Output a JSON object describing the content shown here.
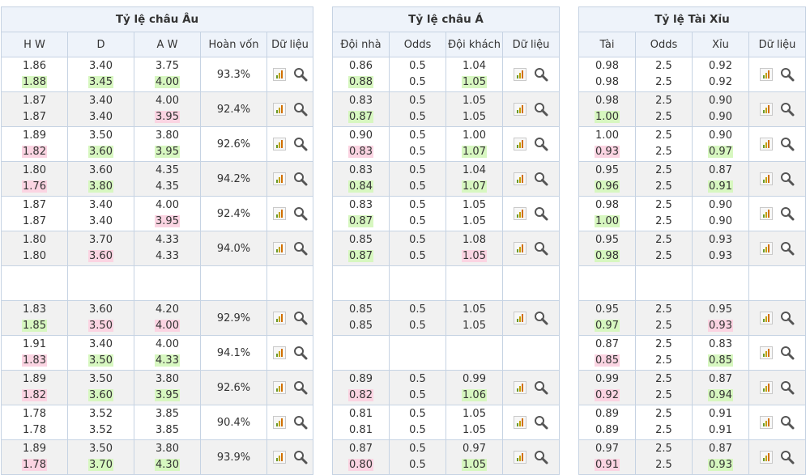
{
  "eu": {
    "title": "Tỷ lệ châu Âu",
    "headers": [
      "H W",
      "D",
      "A W",
      "Hoàn vốn",
      "Dữ liệu"
    ],
    "rows": [
      {
        "hw": [
          "1.86",
          "1.88"
        ],
        "d": [
          "3.40",
          "3.45"
        ],
        "aw": [
          "3.75",
          "4.00"
        ],
        "pct": "93.3%"
      },
      {
        "hw": [
          "1.87",
          "1.87"
        ],
        "d": [
          "3.40",
          "3.40"
        ],
        "aw": [
          "4.00",
          "3.95"
        ],
        "pct": "92.4%"
      },
      {
        "hw": [
          "1.89",
          "1.82"
        ],
        "d": [
          "3.50",
          "3.60"
        ],
        "aw": [
          "3.80",
          "3.95"
        ],
        "pct": "92.6%"
      },
      {
        "hw": [
          "1.80",
          "1.76"
        ],
        "d": [
          "3.60",
          "3.80"
        ],
        "aw": [
          "4.35",
          "4.35"
        ],
        "pct": "94.2%"
      },
      {
        "hw": [
          "1.87",
          "1.87"
        ],
        "d": [
          "3.40",
          "3.40"
        ],
        "aw": [
          "4.00",
          "3.95"
        ],
        "pct": "92.4%"
      },
      {
        "hw": [
          "1.80",
          "1.80"
        ],
        "d": [
          "3.70",
          "3.60"
        ],
        "aw": [
          "4.33",
          "4.33"
        ],
        "pct": "94.0%"
      },
      {
        "hw": [
          "",
          ""
        ],
        "d": [
          "",
          ""
        ],
        "aw": [
          "",
          ""
        ],
        "pct": ""
      },
      {
        "hw": [
          "1.83",
          "1.85"
        ],
        "d": [
          "3.60",
          "3.50"
        ],
        "aw": [
          "4.20",
          "4.00"
        ],
        "pct": "92.9%"
      },
      {
        "hw": [
          "1.91",
          "1.83"
        ],
        "d": [
          "3.40",
          "3.50"
        ],
        "aw": [
          "4.00",
          "4.33"
        ],
        "pct": "94.1%"
      },
      {
        "hw": [
          "1.89",
          "1.82"
        ],
        "d": [
          "3.50",
          "3.60"
        ],
        "aw": [
          "3.80",
          "3.95"
        ],
        "pct": "92.6%"
      },
      {
        "hw": [
          "1.78",
          "1.78"
        ],
        "d": [
          "3.52",
          "3.52"
        ],
        "aw": [
          "3.85",
          "3.85"
        ],
        "pct": "90.4%"
      },
      {
        "hw": [
          "1.89",
          "1.78"
        ],
        "d": [
          "3.50",
          "3.70"
        ],
        "aw": [
          "3.80",
          "4.30"
        ],
        "pct": "93.9%"
      }
    ]
  },
  "asia": {
    "title": "Tỷ lệ châu Á",
    "headers": [
      "Đội nhà",
      "Odds",
      "Đội khách",
      "Dữ liệu"
    ],
    "rows": [
      {
        "home": [
          "0.86",
          "0.88"
        ],
        "odds": [
          "0.5",
          "0.5"
        ],
        "away": [
          "1.04",
          "1.05"
        ]
      },
      {
        "home": [
          "0.83",
          "0.87"
        ],
        "odds": [
          "0.5",
          "0.5"
        ],
        "away": [
          "1.05",
          "1.05"
        ]
      },
      {
        "home": [
          "0.90",
          "0.83"
        ],
        "odds": [
          "0.5",
          "0.5"
        ],
        "away": [
          "1.00",
          "1.07"
        ]
      },
      {
        "home": [
          "0.83",
          "0.84"
        ],
        "odds": [
          "0.5",
          "0.5"
        ],
        "away": [
          "1.04",
          "1.07"
        ]
      },
      {
        "home": [
          "0.83",
          "0.87"
        ],
        "odds": [
          "0.5",
          "0.5"
        ],
        "away": [
          "1.05",
          "1.05"
        ]
      },
      {
        "home": [
          "0.85",
          "0.87"
        ],
        "odds": [
          "0.5",
          "0.5"
        ],
        "away": [
          "1.08",
          "1.05"
        ]
      },
      {
        "home": [
          "",
          ""
        ],
        "odds": [
          "",
          ""
        ],
        "away": [
          "",
          ""
        ]
      },
      {
        "home": [
          "0.85",
          "0.85"
        ],
        "odds": [
          "0.5",
          "0.5"
        ],
        "away": [
          "1.05",
          "1.05"
        ]
      },
      {
        "home": [
          "",
          ""
        ],
        "odds": [
          "",
          ""
        ],
        "away": [
          "",
          ""
        ]
      },
      {
        "home": [
          "0.89",
          "0.82"
        ],
        "odds": [
          "0.5",
          "0.5"
        ],
        "away": [
          "0.99",
          "1.06"
        ]
      },
      {
        "home": [
          "0.81",
          "0.81"
        ],
        "odds": [
          "0.5",
          "0.5"
        ],
        "away": [
          "1.05",
          "1.05"
        ]
      },
      {
        "home": [
          "0.87",
          "0.80"
        ],
        "odds": [
          "0.5",
          "0.5"
        ],
        "away": [
          "0.97",
          "1.05"
        ]
      }
    ]
  },
  "ou": {
    "title": "Tỷ lệ Tài Xỉu",
    "headers": [
      "Tài",
      "Odds",
      "Xỉu",
      "Dữ liệu"
    ],
    "rows": [
      {
        "over": [
          "0.98",
          "0.98"
        ],
        "odds": [
          "2.5",
          "2.5"
        ],
        "under": [
          "0.92",
          "0.92"
        ]
      },
      {
        "over": [
          "0.98",
          "1.00"
        ],
        "odds": [
          "2.5",
          "2.5"
        ],
        "under": [
          "0.90",
          "0.90"
        ]
      },
      {
        "over": [
          "1.00",
          "0.93"
        ],
        "odds": [
          "2.5",
          "2.5"
        ],
        "under": [
          "0.90",
          "0.97"
        ]
      },
      {
        "over": [
          "0.95",
          "0.96"
        ],
        "odds": [
          "2.5",
          "2.5"
        ],
        "under": [
          "0.87",
          "0.91"
        ]
      },
      {
        "over": [
          "0.98",
          "1.00"
        ],
        "odds": [
          "2.5",
          "2.5"
        ],
        "under": [
          "0.90",
          "0.90"
        ]
      },
      {
        "over": [
          "0.95",
          "0.98"
        ],
        "odds": [
          "2.5",
          "2.5"
        ],
        "under": [
          "0.93",
          "0.93"
        ]
      },
      {
        "over": [
          "",
          ""
        ],
        "odds": [
          "",
          ""
        ],
        "under": [
          "",
          ""
        ]
      },
      {
        "over": [
          "0.95",
          "0.97"
        ],
        "odds": [
          "2.5",
          "2.5"
        ],
        "under": [
          "0.95",
          "0.93"
        ]
      },
      {
        "over": [
          "0.87",
          "0.85"
        ],
        "odds": [
          "2.5",
          "2.5"
        ],
        "under": [
          "0.83",
          "0.85"
        ]
      },
      {
        "over": [
          "0.99",
          "0.92"
        ],
        "odds": [
          "2.5",
          "2.5"
        ],
        "under": [
          "0.87",
          "0.94"
        ]
      },
      {
        "over": [
          "0.89",
          "0.89"
        ],
        "odds": [
          "2.5",
          "2.5"
        ],
        "under": [
          "0.91",
          "0.91"
        ]
      },
      {
        "over": [
          "0.97",
          "0.91"
        ],
        "odds": [
          "2.5",
          "2.5"
        ],
        "under": [
          "0.87",
          "0.93"
        ]
      }
    ]
  },
  "icons": {
    "chart": "bar-chart-icon",
    "search": "search-icon"
  },
  "colors": {
    "up_highlight": "#d7f7c0",
    "down_highlight": "#fbd4e2",
    "header_bg": "#eef3fa",
    "border": "#c6d3e3"
  }
}
